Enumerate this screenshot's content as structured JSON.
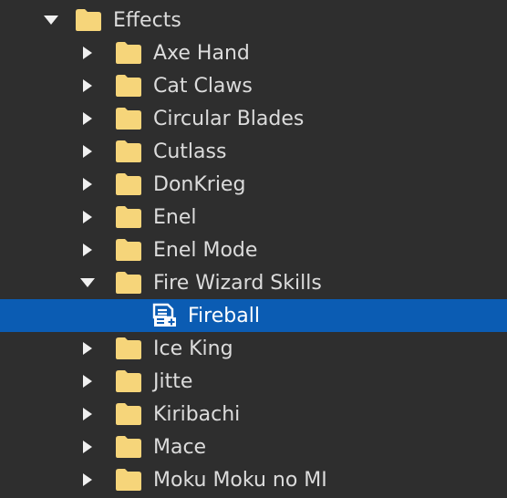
{
  "colors": {
    "background": "#2e2e2e",
    "selected": "#0b5cb3",
    "folder": "#f6d57a",
    "text": "#dcdcdc"
  },
  "tree": {
    "root": {
      "label": "Effects",
      "icon": "folder-icon",
      "expanded": true
    },
    "items": [
      {
        "label": "Axe Hand",
        "icon": "folder-icon",
        "expanded": false
      },
      {
        "label": "Cat Claws",
        "icon": "folder-icon",
        "expanded": false
      },
      {
        "label": "Circular Blades",
        "icon": "folder-icon",
        "expanded": false
      },
      {
        "label": "Cutlass",
        "icon": "folder-icon",
        "expanded": false
      },
      {
        "label": "DonKrieg",
        "icon": "folder-icon",
        "expanded": false
      },
      {
        "label": "Enel",
        "icon": "folder-icon",
        "expanded": false
      },
      {
        "label": "Enel Mode",
        "icon": "folder-icon",
        "expanded": false
      },
      {
        "label": "Fire Wizard Skills",
        "icon": "folder-icon",
        "expanded": true,
        "children": [
          {
            "label": "Fireball",
            "icon": "module-script-icon",
            "selected": true
          }
        ]
      },
      {
        "label": "Ice King",
        "icon": "folder-icon",
        "expanded": false
      },
      {
        "label": "Jitte",
        "icon": "folder-icon",
        "expanded": false
      },
      {
        "label": "Kiribachi",
        "icon": "folder-icon",
        "expanded": false
      },
      {
        "label": "Mace",
        "icon": "folder-icon",
        "expanded": false
      },
      {
        "label": "Moku Moku no MI",
        "icon": "folder-icon",
        "expanded": false
      }
    ]
  }
}
